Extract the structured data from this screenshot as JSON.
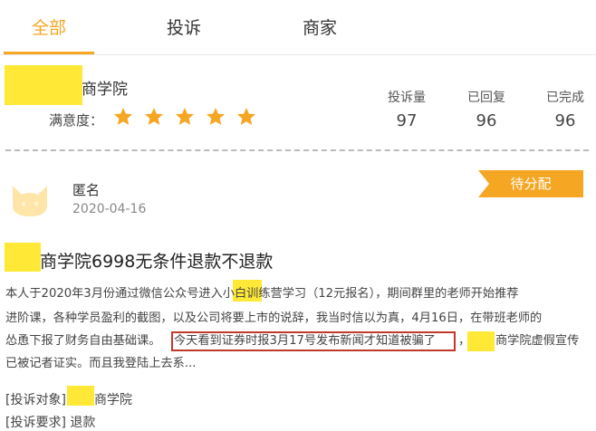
{
  "tabs": [
    {
      "label": "全部",
      "active": true
    },
    {
      "label": "投诉",
      "active": false
    },
    {
      "label": "商家",
      "active": false
    }
  ],
  "merchant": {
    "name": "商学院",
    "satisfaction_label": "满意度：",
    "rating_stars": 5,
    "stats": [
      {
        "label": "投诉量",
        "value": "97"
      },
      {
        "label": "已回复",
        "value": "96"
      },
      {
        "label": "已完成",
        "value": "96"
      }
    ]
  },
  "complaint": {
    "user": "匿名",
    "date": "2020-04-16",
    "status": "待分配",
    "title": "商学院6998无条件退款不退款",
    "body_lines": [
      "本人于2020年3月份通过微信公众号进入小白训练营学习（12元报名），期间群里的老师开始推荐",
      "进阶课，各种学员盈利的截图，以及公司将要上市的说辞，我当时信以为真，4月16日，在带班老师的",
      "怂恿下报了财务自由基础课。",
      "今天看到证券时报3月17号发布新闻才知道被骗了",
      "，",
      "商学院虚假宣传",
      "已被记者证实。而且我登陆上去系..."
    ],
    "target_key": "[投诉对象]",
    "target_value": "商学院",
    "demand_key": "[投诉要求]",
    "demand_value": "退款"
  },
  "colors": {
    "accent": "#f5a623",
    "highlight_border": "#c0392b",
    "redaction": "#ffe936"
  }
}
